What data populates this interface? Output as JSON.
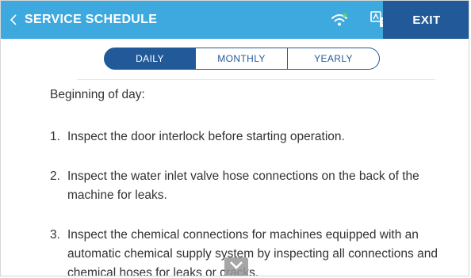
{
  "header": {
    "title": "SERVICE SCHEDULE",
    "exit_label": "EXIT",
    "wifi_icon": "wifi-icon",
    "language_icon": "language-icon",
    "colors": {
      "bar": "#3da9df",
      "exit": "#225a99"
    }
  },
  "tabs": [
    {
      "label": "DAILY",
      "active": true
    },
    {
      "label": "MONTHLY",
      "active": false
    },
    {
      "label": "YEARLY",
      "active": false
    }
  ],
  "content": {
    "heading": "Beginning of day:",
    "steps": [
      {
        "num": "1.",
        "text": "Inspect the door interlock before starting operation."
      },
      {
        "num": "2.",
        "text": "Inspect the water inlet valve hose connections on the back of the machine for leaks."
      },
      {
        "num": "3.",
        "text": "Inspect the chemical connections for machines equipped with an automatic chemical supply system by inspecting all connections and chemical hoses for leaks or cracks."
      }
    ]
  }
}
